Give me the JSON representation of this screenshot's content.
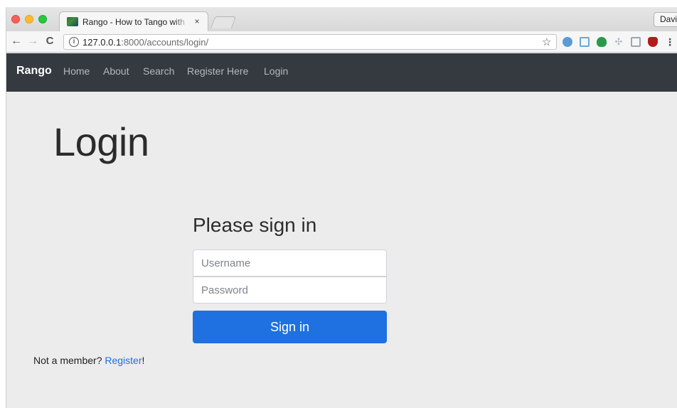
{
  "browser": {
    "tab": {
      "title": "Rango - How to Tango with Dj",
      "close_glyph": "×"
    },
    "profile_label": "David",
    "nav": {
      "back_glyph": "←",
      "forward_glyph": "→",
      "reload_glyph": "C"
    },
    "address": {
      "info_glyph": "i",
      "host": "127.0.0.1",
      "path": ":8000/accounts/login/"
    },
    "star_glyph": "☆",
    "menu_glyph": "⋮",
    "extensions": [
      "extension-blue-icon",
      "extension-screenshot-icon",
      "extension-evernote-icon",
      "extension-dropbox-icon",
      "extension-comment-icon",
      "extension-ublock-icon"
    ]
  },
  "site_nav": {
    "brand": "Rango",
    "links": {
      "home": "Home",
      "about": "About",
      "search": "Search",
      "register": "Register Here",
      "login": "Login"
    }
  },
  "page": {
    "title": "Login",
    "form": {
      "heading": "Please sign in",
      "username_placeholder": "Username",
      "password_placeholder": "Password",
      "submit_label": "Sign in"
    },
    "footer": {
      "prefix": "Not a member? ",
      "link": "Register",
      "suffix": "!"
    }
  },
  "colors": {
    "navbar_bg": "#343a40",
    "primary": "#1f70e0",
    "page_bg": "#ececec"
  }
}
